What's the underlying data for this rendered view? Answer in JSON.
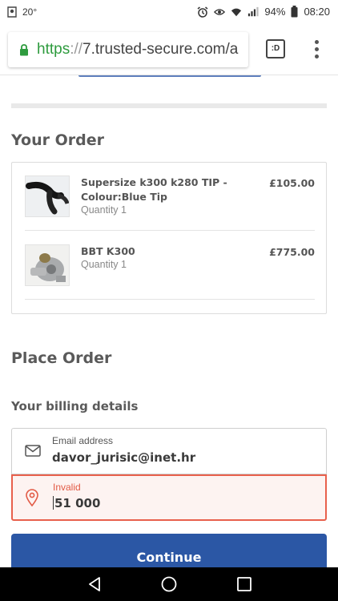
{
  "status_bar": {
    "temperature": "20°",
    "battery": "94%",
    "time": "08:20"
  },
  "browser": {
    "url_scheme": "https",
    "url_sep": "://",
    "url_host": "7.trusted-secure.com/a",
    "tab_button_label": ":D"
  },
  "order": {
    "title": "Your Order",
    "items": [
      {
        "name": "Supersize k300 k280 TIP - Colour:Blue Tip",
        "quantity": "Quantity 1",
        "price": "£105.00"
      },
      {
        "name": "BBT K300",
        "quantity": "Quantity 1",
        "price": "£775.00"
      }
    ]
  },
  "place_order": {
    "title": "Place Order",
    "billing_title": "Your billing details",
    "email": {
      "label": "Email address",
      "value": "davor_jurisic@inet.hr"
    },
    "postcode": {
      "label": "Invalid",
      "value": "51 000"
    },
    "continue_label": "Continue"
  },
  "colors": {
    "accent": "#2b57a5",
    "error": "#e8604c",
    "secure_green": "#2e9b3e"
  }
}
